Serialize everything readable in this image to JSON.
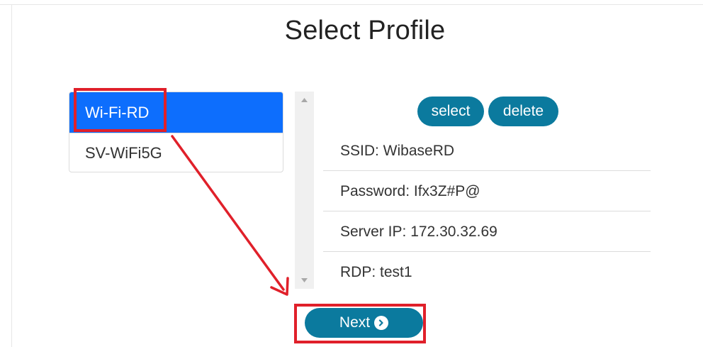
{
  "page": {
    "title": "Select Profile"
  },
  "profiles": {
    "items": [
      {
        "label": "Wi-Fi-RD",
        "selected": true
      },
      {
        "label": "SV-WiFi5G",
        "selected": false
      }
    ]
  },
  "actions": {
    "select_label": "select",
    "delete_label": "delete"
  },
  "details": {
    "ssid": "SSID: WibaseRD",
    "password": "Password: Ifx3Z#P@",
    "server_ip": "Server IP: 172.30.32.69",
    "rdp": "RDP: test1"
  },
  "footer": {
    "next_label": "Next"
  },
  "icons": {
    "next": "chevron-right-circle-icon",
    "scroll_up": "scroll-up-arrow-icon",
    "scroll_down": "scroll-down-arrow-icon"
  },
  "colors": {
    "selected_item": "#0d6efd",
    "button": "#0b7a9e",
    "annotation": "#e0202a"
  }
}
